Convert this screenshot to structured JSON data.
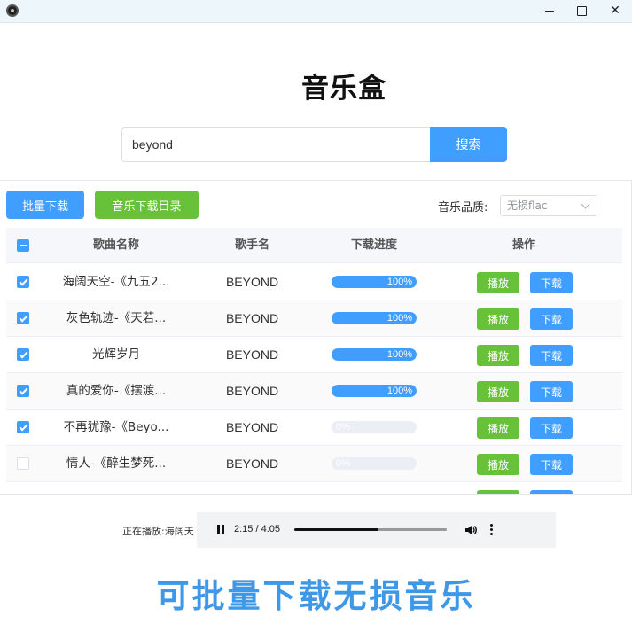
{
  "window": {
    "close_glyph": "✕"
  },
  "app": {
    "title": "音乐盒"
  },
  "search": {
    "value": "beyond",
    "button_label": "搜索"
  },
  "toolbar": {
    "batch_download_label": "批量下载",
    "download_dir_label": "音乐下载目录",
    "quality_label": "音乐品质:",
    "quality_selected": "无损flac"
  },
  "table": {
    "header_checkbox_state": "indeterminate",
    "columns": [
      "歌曲名称",
      "歌手名",
      "下载进度",
      "操作"
    ],
    "play_label": "播放",
    "download_label": "下载",
    "rows": [
      {
        "name": "海阔天空-《九五2...",
        "singer": "BEYOND",
        "progress": 100,
        "progress_text": "100%",
        "checked": true
      },
      {
        "name": "灰色轨迹-《天若...",
        "singer": "BEYOND",
        "progress": 100,
        "progress_text": "100%",
        "checked": true
      },
      {
        "name": "光辉岁月",
        "singer": "BEYOND",
        "progress": 100,
        "progress_text": "100%",
        "checked": true
      },
      {
        "name": "真的爱你-《摆渡...",
        "singer": "BEYOND",
        "progress": 100,
        "progress_text": "100%",
        "checked": true
      },
      {
        "name": "不再犹豫-《Beyo...",
        "singer": "BEYOND",
        "progress": 0,
        "progress_text": "0%",
        "checked": true
      },
      {
        "name": "情人-《醉生梦死...",
        "singer": "BEYOND",
        "progress": 0,
        "progress_text": "0%",
        "checked": false
      },
      {
        "name": "",
        "singer": "",
        "progress": 0,
        "progress_text": "",
        "checked": false
      }
    ]
  },
  "player": {
    "now_playing_label": "正在播放:",
    "now_playing_title": "海阔天",
    "time": "2:15 / 4:05",
    "position_fraction": 0.55
  },
  "banner": {
    "text": "可批量下载无损音乐"
  },
  "colors": {
    "primary": "#409eff",
    "success": "#67c23a",
    "banner": "#3d98e8"
  }
}
